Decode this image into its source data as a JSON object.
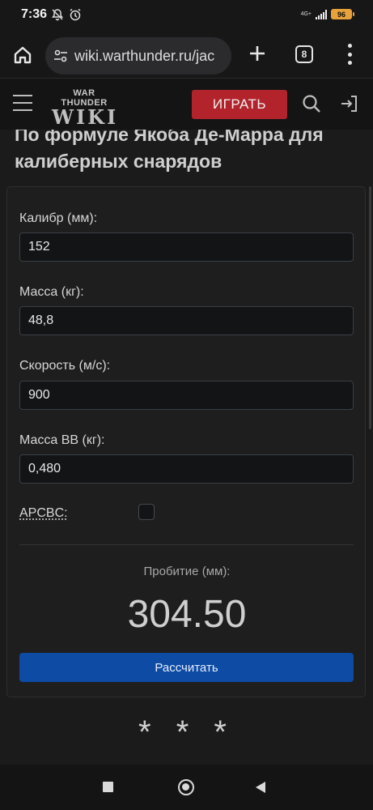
{
  "status_bar": {
    "time": "7:36",
    "network": "4G+",
    "battery": "96",
    "icons": [
      "notification-off-icon",
      "alarm-icon",
      "signal-icon",
      "battery-icon"
    ]
  },
  "browser": {
    "url": "wiki.warthunder.ru/jac",
    "tab_count": "8",
    "icons": [
      "home-icon",
      "site-settings-icon",
      "new-tab-plus-icon",
      "tabs-icon",
      "more-menu-icon"
    ]
  },
  "site_header": {
    "logo_top": "WAR THUNDER",
    "logo_main": "WIKI",
    "play_label": "ИГРАТЬ",
    "icons": [
      "hamburger-menu-icon",
      "search-icon",
      "login-icon"
    ]
  },
  "calculator": {
    "heading": "По формуле Якоба Де-Марра для калиберных снарядов",
    "fields": [
      {
        "label": "Калибр (мм):",
        "value": "152"
      },
      {
        "label": "Масса (кг):",
        "value": "48,8"
      },
      {
        "label": "Скорость (м/с):",
        "value": "900"
      },
      {
        "label": "Масса ВВ (кг):",
        "value": "0,480"
      }
    ],
    "apcbc_label": "APCBC:",
    "apcbc_checked": false,
    "result_label": "Пробитие (мм):",
    "result_value": "304.50",
    "calculate_label": "Рассчитать"
  },
  "separator": "* * *",
  "colors": {
    "play_button": "#b3232b",
    "calculate_button": "#0d4ba5",
    "background": "#1b1b1b"
  }
}
